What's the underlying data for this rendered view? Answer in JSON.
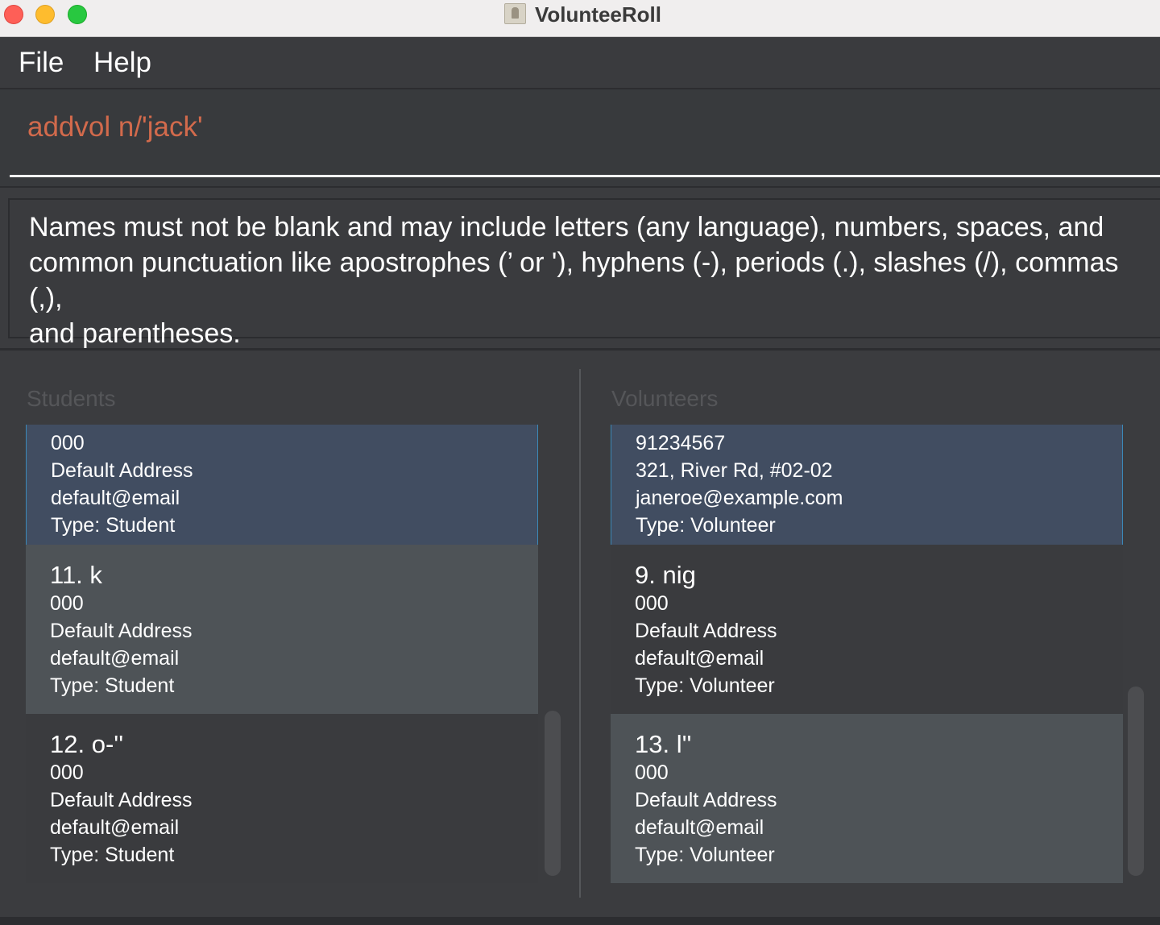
{
  "window": {
    "title": "VolunteeRoll"
  },
  "menu": {
    "file": "File",
    "help": "Help"
  },
  "command": {
    "text": "addvol n/'jack'"
  },
  "result": {
    "line1": "Names must not be blank and may include letters (any language), numbers, spaces, and",
    "line2": "common punctuation like apostrophes (’ or '), hyphens (-), periods (.), slashes (/), commas (,),",
    "line3": "and parentheses."
  },
  "students": {
    "title": "Students",
    "cards": [
      {
        "name": "",
        "phone": "000",
        "address": "Default Address",
        "email": "default@email",
        "type": "Type: Student"
      },
      {
        "name": "11. k",
        "phone": "000",
        "address": "Default Address",
        "email": "default@email",
        "type": "Type: Student"
      },
      {
        "name": "12. o-''",
        "phone": "000",
        "address": "Default Address",
        "email": "default@email",
        "type": "Type: Student"
      }
    ]
  },
  "volunteers": {
    "title": "Volunteers",
    "cards": [
      {
        "name": "",
        "phone": "91234567",
        "address": "321, River Rd, #02-02",
        "email": "janeroe@example.com",
        "type": "Type: Volunteer"
      },
      {
        "name": "9. nig",
        "phone": "000",
        "address": "Default Address",
        "email": "default@email",
        "type": "Type: Volunteer"
      },
      {
        "name": "13. l''",
        "phone": "000",
        "address": "Default Address",
        "email": "default@email",
        "type": "Type: Volunteer"
      }
    ]
  },
  "colors": {
    "background": "#3b3c3f",
    "command_text": "#d26a4c",
    "selected_card": "#414d61",
    "selected_border": "#3c88b7"
  }
}
